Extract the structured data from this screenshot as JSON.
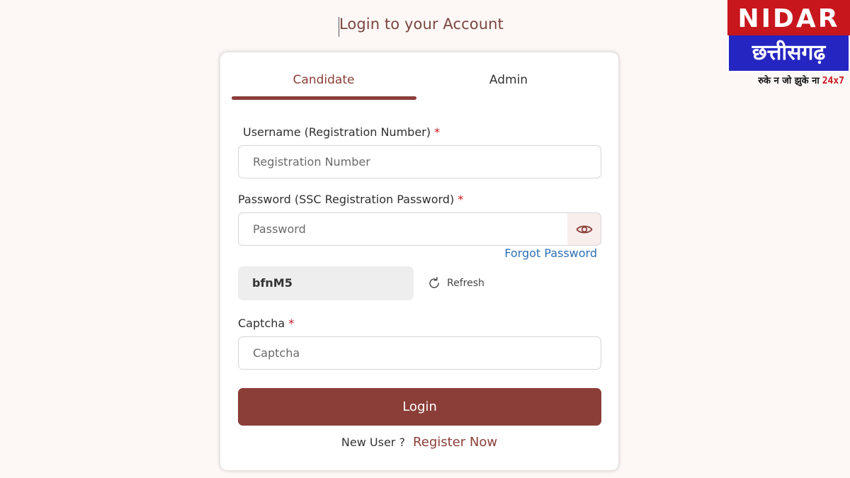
{
  "page": {
    "title": "Login to your Account"
  },
  "logo": {
    "brand": "NIDAR",
    "region": "छत्तीसगढ़",
    "tagline": "रुके न जो झुके ना",
    "tagline_highlight": "24x7"
  },
  "tabs": [
    {
      "label": "Candidate",
      "active": true
    },
    {
      "label": "Admin",
      "active": false
    }
  ],
  "form": {
    "username": {
      "label": "Username (Registration Number)",
      "required_mark": "*",
      "placeholder": "Registration Number",
      "value": ""
    },
    "password": {
      "label": "Password (SSC Registration Password)",
      "required_mark": "*",
      "placeholder": "Password",
      "value": ""
    },
    "forgot_password": "Forgot Password",
    "captcha_code": "bfnM5",
    "refresh_label": "Refresh",
    "captcha": {
      "label": "Captcha",
      "required_mark": "*",
      "placeholder": "Captcha",
      "value": ""
    },
    "login_label": "Login",
    "new_user_text": "New User ?",
    "register_label": "Register Now"
  },
  "colors": {
    "accent": "#8b3e38",
    "link": "#2f6fb5",
    "required": "#c8161d",
    "logo_red": "#c8161d",
    "logo_blue": "#2525c2"
  },
  "icons": {
    "password_toggle": "eye-icon",
    "refresh": "refresh-icon"
  }
}
